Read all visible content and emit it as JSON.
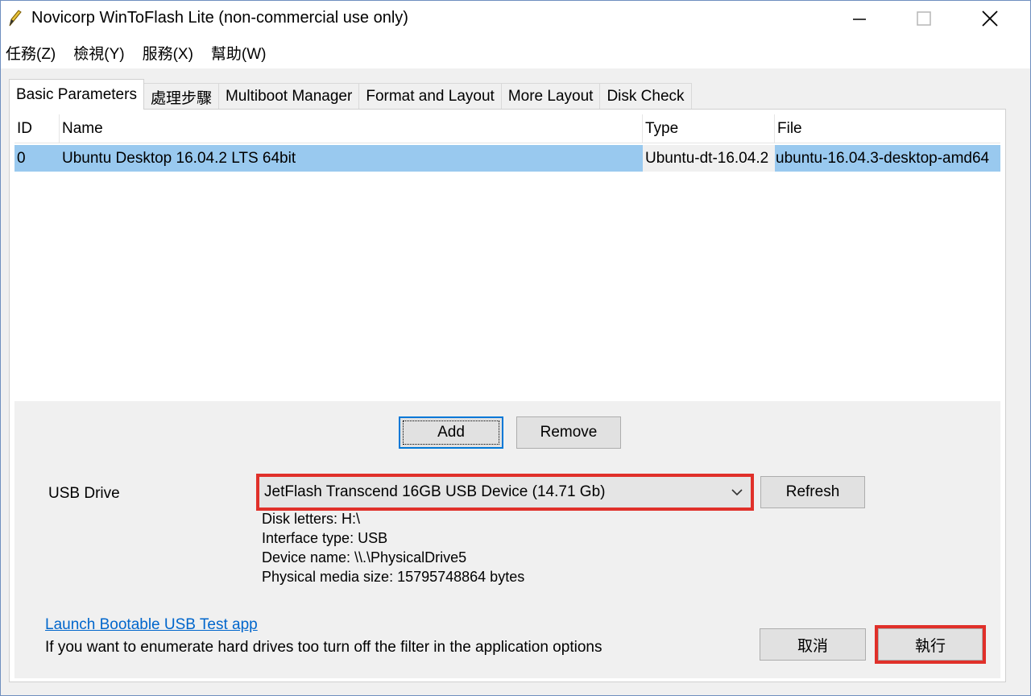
{
  "window": {
    "title": "Novicorp WinToFlash Lite (non-commercial use only)"
  },
  "menu": [
    "任務(Z)",
    "檢視(Y)",
    "服務(X)",
    "幫助(W)"
  ],
  "tabs": [
    "Basic Parameters",
    "處理步驟",
    "Multiboot Manager",
    "Format and Layout",
    "More Layout",
    "Disk Check"
  ],
  "list": {
    "columns": [
      "ID",
      "Name",
      "Type",
      "File"
    ],
    "rows": [
      {
        "id": "0",
        "name": "Ubuntu Desktop 16.04.2 LTS 64bit",
        "type": "Ubuntu-dt-16.04.2",
        "file": "ubuntu-16.04.3-desktop-amd64"
      }
    ]
  },
  "buttons": {
    "add": "Add",
    "remove": "Remove",
    "refresh": "Refresh",
    "cancel": "取消",
    "execute": "執行"
  },
  "usb": {
    "label": "USB Drive",
    "selected": "JetFlash Transcend 16GB USB Device (14.71 Gb)",
    "disk_letters": "Disk letters: H:\\",
    "interface_type": "Interface type: USB",
    "device_name": "Device name: \\\\.\\PhysicalDrive5",
    "media_size": "Physical media size: 15795748864 bytes"
  },
  "footer": {
    "launch_link": "Launch Bootable USB Test app",
    "hint": "If you want to enumerate hard drives too turn off the filter in the application options"
  },
  "colors": {
    "selection": "#99c9ef",
    "highlight_box": "#e0302a",
    "link": "#0066cc"
  }
}
